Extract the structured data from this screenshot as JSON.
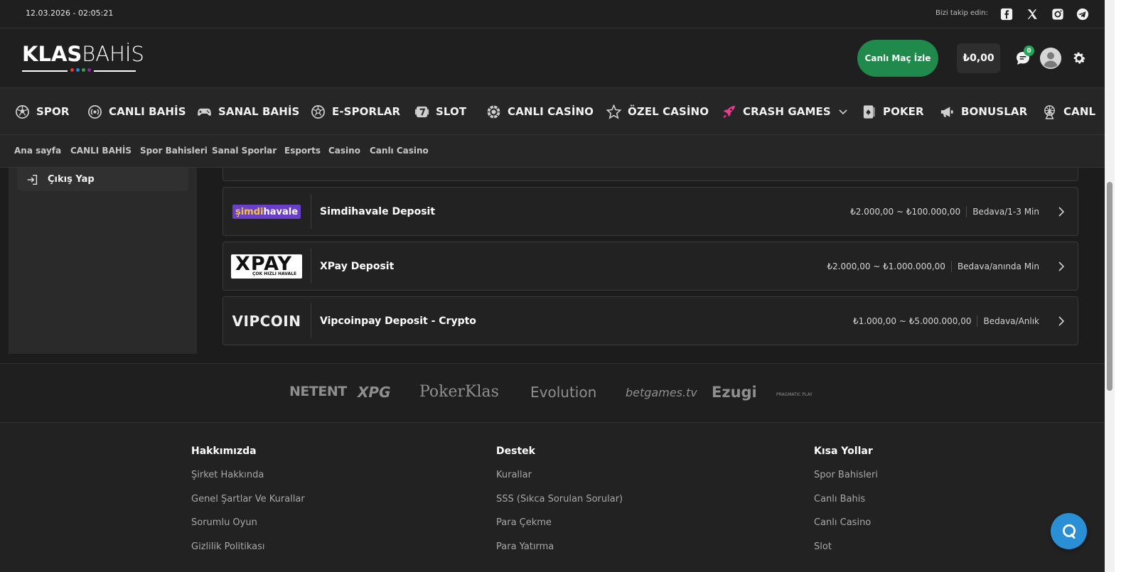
{
  "topbar": {
    "datetime": "12.03.2026 - 02:05:21",
    "follow_label": "Bizi takip edin:",
    "social_icons": [
      "facebook-icon",
      "x-icon",
      "instagram-icon",
      "telegram-icon"
    ]
  },
  "header": {
    "logo": {
      "bold": "KLAS",
      "thin": "BAHİS",
      "dot_colors": [
        "#e53935",
        "#1e88e5",
        "#43a047",
        "#8e24aa"
      ]
    },
    "live_button": "Canlı Maç İzle",
    "balance": "₺0,00",
    "chat_badge": "0",
    "accent_green": "#1f8a4c"
  },
  "nav": {
    "items": [
      {
        "label": "SPOR",
        "icon": "soccer-ball-icon"
      },
      {
        "label": "CANLI BAHİS",
        "icon": "live-signal-icon"
      },
      {
        "label": "SANAL BAHİS",
        "icon": "gamepad-icon"
      },
      {
        "label": "E-SPORLAR",
        "icon": "esports-ball-icon"
      },
      {
        "label": "SLOT",
        "icon": "slot-seven-icon"
      },
      {
        "label": "CANLI CASİNO",
        "icon": "casino-chip-icon"
      },
      {
        "label": "ÖZEL CASİNO",
        "icon": "star-icon"
      },
      {
        "label": "CRASH GAMES",
        "icon": "rocket-icon"
      },
      {
        "label": "POKER",
        "icon": "playing-card-icon"
      },
      {
        "label": "BONUSLAR",
        "icon": "megaphone-icon"
      },
      {
        "label": "CANL",
        "icon": "ferris-wheel-icon"
      }
    ]
  },
  "breadcrumbs": [
    "Ana sayfa",
    "CANLI BAHİS",
    "Spor Bahisleri",
    "Sanal Sporlar",
    "Esports",
    "Casino",
    "Canlı Casino"
  ],
  "sidebar": {
    "logout_label": "Çıkış Yap"
  },
  "payments": [
    {
      "logo": "şimdihavale",
      "name": "Simdihavale Deposit",
      "range": "₺2.000,00 ~ ₺100.000,00",
      "fee_time": "Bedava/1-3 Min"
    },
    {
      "logo": "XPAY",
      "logo_sub": "ÇOK HIZLI HAVALE",
      "name": "XPay Deposit",
      "range": "₺2.000,00 ~ ₺1.000.000,00",
      "fee_time": "Bedava/anında Min"
    },
    {
      "logo": "VIPCOIN",
      "name": "Vipcoinpay Deposit - Crypto",
      "range": "₺1.000,00 ~ ₺5.000.000,00",
      "fee_time": "Bedava/Anlık"
    }
  ],
  "providers": [
    "NETENT",
    "XPG",
    "PokerKlas",
    "Evolution",
    "betgames.tv",
    "Ezugi",
    "PRAGMATIC PLAY"
  ],
  "footer": {
    "columns": [
      {
        "title": "Hakkımızda",
        "links": [
          "Şirket Hakkında",
          "Genel Şartlar Ve Kurallar",
          "Sorumlu Oyun",
          "Gizlilik Politikası"
        ]
      },
      {
        "title": "Destek",
        "links": [
          "Kurallar",
          "SSS (Sıkca Sorulan Sorular)",
          "Para Çekme",
          "Para Yatırma"
        ]
      },
      {
        "title": "Kısa Yollar",
        "links": [
          "Spor Bahisleri",
          "Canlı Bahis",
          "Canlı Casino",
          "Slot"
        ]
      }
    ]
  }
}
